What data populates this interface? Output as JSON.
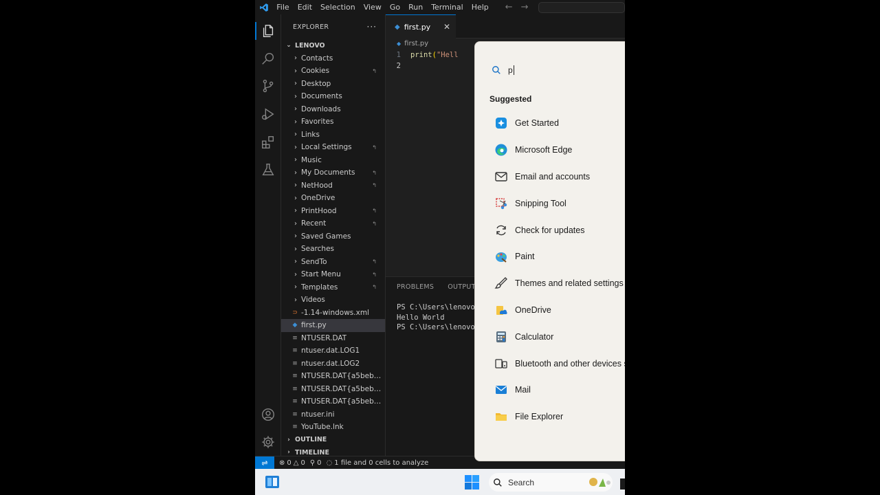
{
  "titlebar": {
    "menu": [
      "File",
      "Edit",
      "Selection",
      "View",
      "Go",
      "Run",
      "Terminal",
      "Help"
    ]
  },
  "explorer": {
    "title": "EXPLORER",
    "more": "···",
    "root": "LENOVO",
    "items": [
      {
        "label": "Contacts",
        "type": "folder",
        "link": false
      },
      {
        "label": "Cookies",
        "type": "folder",
        "link": true
      },
      {
        "label": "Desktop",
        "type": "folder",
        "link": false
      },
      {
        "label": "Documents",
        "type": "folder",
        "link": false
      },
      {
        "label": "Downloads",
        "type": "folder",
        "link": false
      },
      {
        "label": "Favorites",
        "type": "folder",
        "link": false
      },
      {
        "label": "Links",
        "type": "folder",
        "link": false
      },
      {
        "label": "Local Settings",
        "type": "folder",
        "link": true
      },
      {
        "label": "Music",
        "type": "folder",
        "link": false
      },
      {
        "label": "My Documents",
        "type": "folder",
        "link": true
      },
      {
        "label": "NetHood",
        "type": "folder",
        "link": true
      },
      {
        "label": "OneDrive",
        "type": "folder",
        "link": false
      },
      {
        "label": "PrintHood",
        "type": "folder",
        "link": true
      },
      {
        "label": "Recent",
        "type": "folder",
        "link": true
      },
      {
        "label": "Saved Games",
        "type": "folder",
        "link": false
      },
      {
        "label": "Searches",
        "type": "folder",
        "link": false
      },
      {
        "label": "SendTo",
        "type": "folder",
        "link": true
      },
      {
        "label": "Start Menu",
        "type": "folder",
        "link": true
      },
      {
        "label": "Templates",
        "type": "folder",
        "link": true
      },
      {
        "label": "Videos",
        "type": "folder",
        "link": false
      },
      {
        "label": "-1.14-windows.xml",
        "type": "xml",
        "link": false
      },
      {
        "label": "first.py",
        "type": "py",
        "link": false,
        "selected": true
      },
      {
        "label": "NTUSER.DAT",
        "type": "file",
        "link": false
      },
      {
        "label": "ntuser.dat.LOG1",
        "type": "file",
        "link": false
      },
      {
        "label": "ntuser.dat.LOG2",
        "type": "file",
        "link": false
      },
      {
        "label": "NTUSER.DAT{a5beb243...",
        "type": "file",
        "link": false
      },
      {
        "label": "NTUSER.DAT{a5beb243...",
        "type": "file",
        "link": false
      },
      {
        "label": "NTUSER.DAT{a5beb243...",
        "type": "file",
        "link": false
      },
      {
        "label": "ntuser.ini",
        "type": "file",
        "link": false
      },
      {
        "label": "YouTube.lnk",
        "type": "file",
        "link": false
      }
    ],
    "outline": "OUTLINE",
    "timeline": "TIMELINE"
  },
  "editor": {
    "tab_label": "first.py",
    "breadcrumb": "first.py",
    "lines": [
      {
        "num": "1",
        "fn": "print",
        "open": "(",
        "str": "\"Hell"
      },
      {
        "num": "2",
        "fn": "",
        "open": "",
        "str": ""
      }
    ]
  },
  "panel": {
    "tabs": [
      "PROBLEMS",
      "OUTPUT"
    ],
    "terminal": [
      "PS C:\\Users\\lenovo>",
      "Hello World",
      "PS C:\\Users\\lenovo>"
    ]
  },
  "statusbar": {
    "errors": "0",
    "warnings": "0",
    "ports": "0",
    "analysis": "1 file and 0 cells to analyze"
  },
  "taskbar": {
    "search_label": "Search"
  },
  "start_search": {
    "query": "p",
    "section": "Suggested",
    "items": [
      {
        "label": "Get Started",
        "icon": "get-started-icon"
      },
      {
        "label": "Microsoft Edge",
        "icon": "edge-icon"
      },
      {
        "label": "Email and accounts",
        "icon": "mail-outline-icon"
      },
      {
        "label": "Snipping Tool",
        "icon": "snipping-tool-icon"
      },
      {
        "label": "Check for updates",
        "icon": "refresh-icon"
      },
      {
        "label": "Paint",
        "icon": "paint-icon"
      },
      {
        "label": "Themes and related settings",
        "icon": "brush-icon"
      },
      {
        "label": "OneDrive",
        "icon": "onedrive-icon"
      },
      {
        "label": "Calculator",
        "icon": "calculator-icon"
      },
      {
        "label": "Bluetooth and other devices se",
        "icon": "bluetooth-devices-icon"
      },
      {
        "label": "Mail",
        "icon": "mail-app-icon"
      },
      {
        "label": "File Explorer",
        "icon": "folder-icon"
      }
    ]
  },
  "colors": {
    "accent": "#0078d4",
    "editor_bg": "#1f1f1f",
    "sidebar_bg": "#181818",
    "start_panel_bg": "#f3f1ec"
  }
}
